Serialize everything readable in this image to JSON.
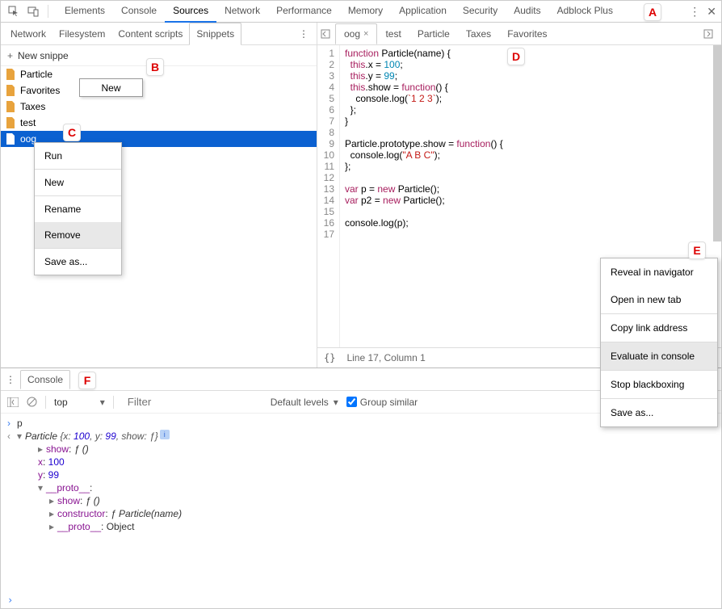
{
  "top_tabs": {
    "items": [
      "Elements",
      "Console",
      "Sources",
      "Network",
      "Performance",
      "Memory",
      "Application",
      "Security",
      "Audits",
      "Adblock Plus"
    ],
    "active": "Sources"
  },
  "sub_tabs": {
    "items": [
      "Network",
      "Filesystem",
      "Content scripts",
      "Snippets"
    ],
    "active": "Snippets"
  },
  "new_snippet_label": "New snippe",
  "tooltip_new": "New",
  "snippets": [
    {
      "name": "Particle"
    },
    {
      "name": "Favorites"
    },
    {
      "name": "Taxes"
    },
    {
      "name": "test",
      "modified": true
    },
    {
      "name": "oog",
      "selected": true
    }
  ],
  "context_menu_c": [
    "Run",
    "New",
    "Rename",
    "Remove",
    "Save as..."
  ],
  "context_menu_c_hover": "Remove",
  "editor_tabs": {
    "items": [
      "oog",
      "test",
      "Particle",
      "Taxes",
      "Favorites"
    ],
    "active": "oog"
  },
  "code_lines": [
    "function Particle(name) {",
    "  this.x = 100;",
    "  this.y = 99;",
    "  this.show = function() {",
    "    console.log(`1 2 3`);",
    "  };",
    "}",
    "",
    "Particle.prototype.show = function() {",
    "  console.log(\"A B C\");",
    "};",
    "",
    "var p = new Particle();",
    "var p2 = new Particle();",
    "",
    "console.log(p);",
    ""
  ],
  "status_bar": {
    "pos": "Line 17, Column 1"
  },
  "context_menu_e": [
    "Reveal in navigator",
    "Open in new tab",
    "Copy link address",
    "Evaluate in console",
    "Stop blackboxing",
    "Save as..."
  ],
  "context_menu_e_hover": "Evaluate in console",
  "drawer": {
    "tab": "Console",
    "context": "top",
    "filter_placeholder": "Filter",
    "levels": "Default levels",
    "group": "Group similar"
  },
  "console": {
    "input": "p",
    "header": "Particle {x: 100, y: 99, show: ƒ}",
    "props": [
      {
        "key": "show",
        "val": "ƒ ()",
        "arrow": true
      },
      {
        "key": "x",
        "val": "100"
      },
      {
        "key": "y",
        "val": "99"
      },
      {
        "key": "__proto__",
        "val": ":",
        "expanded": true
      }
    ],
    "proto_props": [
      {
        "key": "show",
        "val": "ƒ ()",
        "arrow": true
      },
      {
        "key": "constructor",
        "val": "ƒ Particle(name)",
        "arrow": true
      },
      {
        "key": "__proto__",
        "val": ": Object",
        "arrow": true
      }
    ]
  },
  "markers": {
    "A": "A",
    "B": "B",
    "C": "C",
    "D": "D",
    "E": "E",
    "F": "F"
  }
}
